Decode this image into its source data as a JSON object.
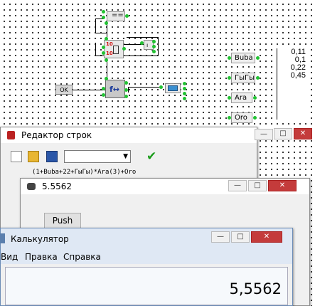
{
  "diagram": {
    "blocks": {
      "eq_label": "==",
      "counter_top": "10",
      "counter_bottom": "10",
      "ok_label": "OK"
    },
    "inputs": [
      {
        "label": "Buba"
      },
      {
        "label": "ГыГы"
      },
      {
        "label": "Ara"
      },
      {
        "label": "Oro"
      }
    ],
    "value_list": [
      "0,11",
      "0,1",
      "0,22",
      "0,45"
    ]
  },
  "editor_window": {
    "title": "Редактор строк",
    "controls": {
      "minimize": "—",
      "maximize": "□",
      "close": "✕"
    },
    "combo_value": "",
    "expression": "(1+Buba+22+ГыГы)*Ara(3)+Oro"
  },
  "result_window": {
    "title": "5.5562",
    "controls": {
      "minimize": "—",
      "maximize": "□",
      "close": "✕"
    },
    "push_label": "Push"
  },
  "calculator": {
    "title": "Калькулятор",
    "controls": {
      "minimize": "—",
      "maximize": "□",
      "close": "✕"
    },
    "menu": [
      "Вид",
      "Правка",
      "Справка"
    ],
    "display": "5,5562"
  }
}
